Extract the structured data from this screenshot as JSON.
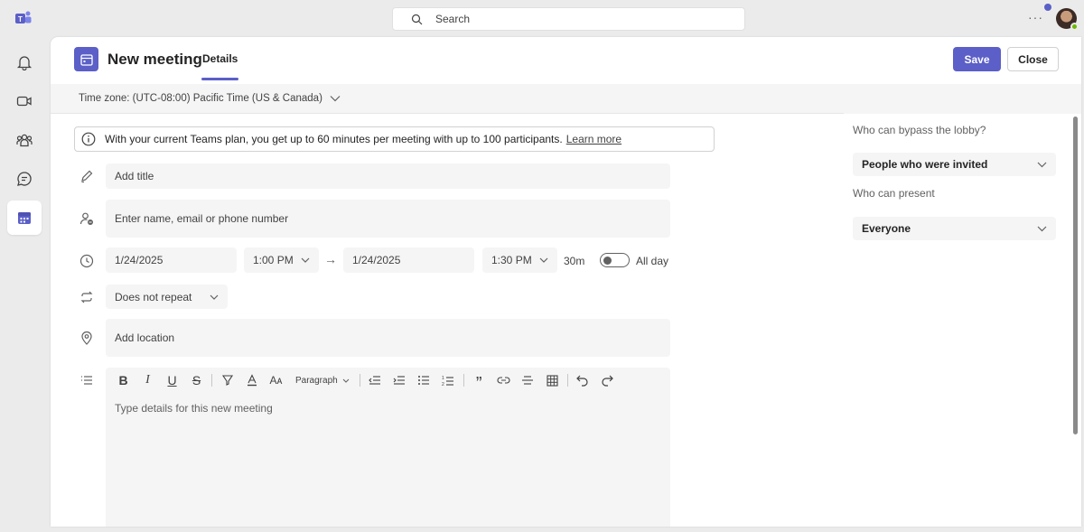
{
  "topbar": {
    "search_placeholder": "Search",
    "more_label": "···"
  },
  "rail": {
    "items": [
      {
        "icon": "bell-icon"
      },
      {
        "icon": "video-icon"
      },
      {
        "icon": "people-icon"
      },
      {
        "icon": "chat-icon"
      },
      {
        "icon": "calendar-icon",
        "active": true
      }
    ]
  },
  "header": {
    "title": "New meeting",
    "tab": "Details",
    "save_label": "Save",
    "close_label": "Close"
  },
  "timezone": {
    "label": "Time zone: (UTC-08:00) Pacific Time (US & Canada)"
  },
  "banner": {
    "text": "With your current Teams plan, you get up to 60 minutes per meeting with up to 100 participants.",
    "link": "Learn more"
  },
  "form": {
    "title_placeholder": "Add title",
    "attendees_placeholder": "Enter name, email or phone number",
    "start_date": "1/24/2025",
    "start_time": "1:00 PM",
    "arrow": "→",
    "end_date": "1/24/2025",
    "end_time": "1:30 PM",
    "duration": "30m",
    "all_day_label": "All day",
    "repeat": "Does not repeat",
    "location_placeholder": "Add location",
    "details_placeholder": "Type details for this new meeting"
  },
  "editor_toolbar": {
    "bold": "B",
    "italic": "I",
    "underline": "U",
    "strike": "S",
    "font_size": "Aᴀ",
    "paragraph": "Paragraph",
    "quote": "”"
  },
  "side": {
    "lobby_label": "Who can bypass the lobby?",
    "lobby_value": "People who were invited",
    "present_label": "Who can present",
    "present_value": "Everyone"
  },
  "colors": {
    "accent": "#5b5fc7",
    "presence": "#6bb700"
  }
}
